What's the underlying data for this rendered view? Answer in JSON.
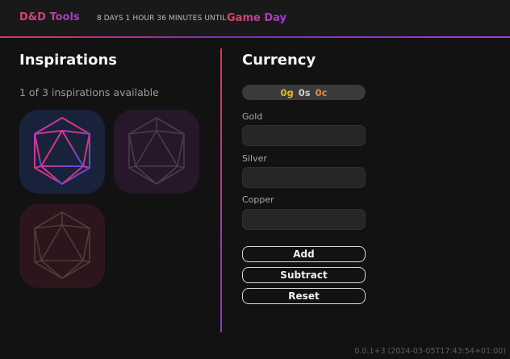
{
  "header": {
    "brand": "D&D Tools",
    "countdown": "8 DAYS 1 HOUR 36 MINUTES UNTIL",
    "event": "Game Day"
  },
  "inspirations": {
    "title": "Inspirations",
    "status": "1 of 3 inspirations available",
    "dice": [
      {
        "name": "d20-icon",
        "state": "available"
      },
      {
        "name": "d20-icon",
        "state": "used"
      },
      {
        "name": "d20-icon",
        "state": "used"
      }
    ]
  },
  "currency": {
    "title": "Currency",
    "summary": {
      "gold": "0g",
      "silver": "0s",
      "copper": "0c"
    },
    "fields": [
      {
        "label": "Gold",
        "value": "",
        "placeholder": ""
      },
      {
        "label": "Silver",
        "value": "",
        "placeholder": ""
      },
      {
        "label": "Copper",
        "value": "",
        "placeholder": ""
      }
    ],
    "buttons": {
      "add": "Add",
      "subtract": "Subtract",
      "reset": "Reset"
    }
  },
  "colors": {
    "gold": "#f0b429",
    "silver": "#cfcfcf",
    "copper": "#e8883a",
    "accent_red": "#e2445a",
    "accent_purple": "#9b3ed8"
  },
  "footer": {
    "version": "0.0.1+3 (2024-03-05T17:43:54+01:00)"
  }
}
